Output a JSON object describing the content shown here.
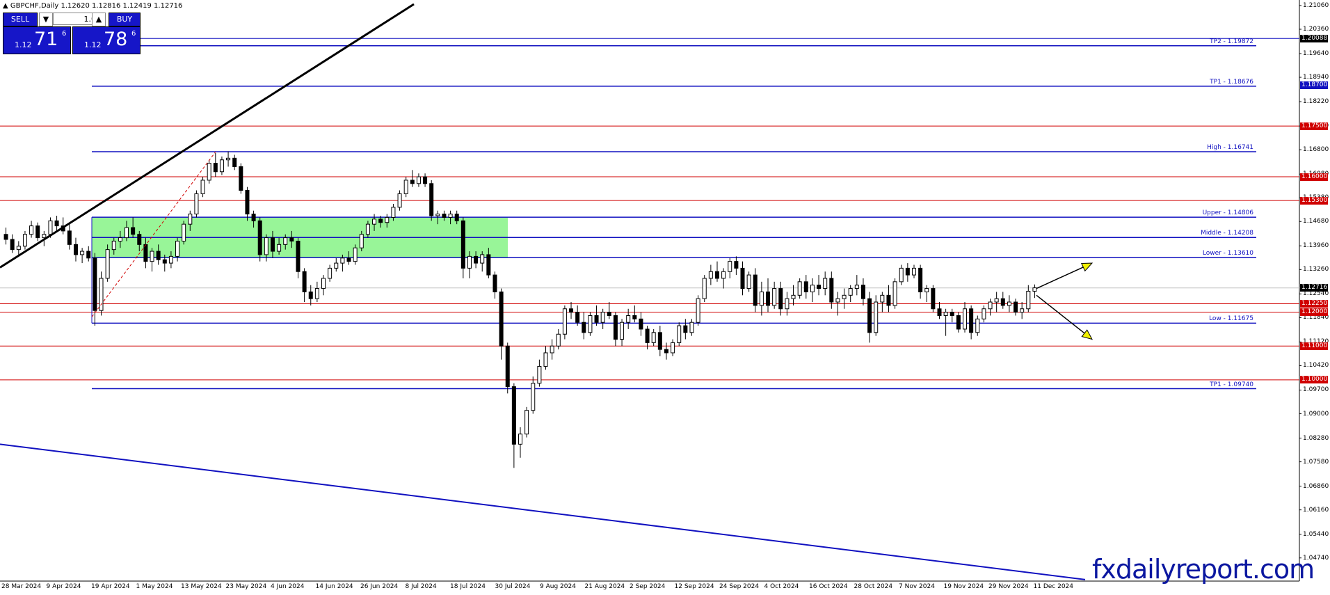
{
  "header": {
    "symbol": "GBPCHF,Daily",
    "ohlc": "1.12620 1.12816 1.12419 1.12716"
  },
  "trade_panel": {
    "sell_label": "SELL",
    "buy_label": "BUY",
    "lot": "1.00",
    "sell_prefix": "1.12",
    "sell_big": "71",
    "sell_sup": "6",
    "buy_prefix": "1.12",
    "buy_big": "78",
    "buy_sup": "6"
  },
  "watermark": "fxdailyreport.com",
  "colors": {
    "blue": "#1010c0",
    "red": "#d00000",
    "green_zone": "#98f598",
    "black": "#000000",
    "arrow_fill": "#f0f000"
  },
  "chart_data": {
    "type": "candlestick",
    "ylim": [
      1.042,
      1.211
    ],
    "y_ticks": [
      "1.21060",
      "1.20360",
      "1.19640",
      "1.18940",
      "1.18220",
      "1.17500",
      "1.16800",
      "1.16080",
      "1.15380",
      "1.14680",
      "1.13960",
      "1.13260",
      "1.12540",
      "1.11840",
      "1.11120",
      "1.10420",
      "1.09700",
      "1.09000",
      "1.08280",
      "1.07580",
      "1.06860",
      "1.06160",
      "1.05440",
      "1.04740"
    ],
    "x_labels": [
      "28 Mar 2024",
      "9 Apr 2024",
      "19 Apr 2024",
      "1 May 2024",
      "13 May 2024",
      "23 May 2024",
      "4 Jun 2024",
      "14 Jun 2024",
      "26 Jun 2024",
      "8 Jul 2024",
      "18 Jul 2024",
      "30 Jul 2024",
      "9 Aug 2024",
      "21 Aug 2024",
      "2 Sep 2024",
      "12 Sep 2024",
      "24 Sep 2024",
      "4 Oct 2024",
      "16 Oct 2024",
      "28 Oct 2024",
      "7 Nov 2024",
      "19 Nov 2024",
      "29 Nov 2024",
      "11 Dec 2024"
    ],
    "current_price": "1.12716",
    "price_badges": [
      {
        "value": "1.20088",
        "color": "#000000"
      },
      {
        "value": "1.18700",
        "color": "#1010c0"
      },
      {
        "value": "1.17500",
        "color": "#d00000"
      },
      {
        "value": "1.16000",
        "color": "#d00000"
      },
      {
        "value": "1.15300",
        "color": "#d00000"
      },
      {
        "value": "1.12716",
        "color": "#000000"
      },
      {
        "value": "1.12250",
        "color": "#d00000"
      },
      {
        "value": "1.12000",
        "color": "#d00000"
      },
      {
        "value": "1.11000",
        "color": "#d00000"
      },
      {
        "value": "1.10000",
        "color": "#d00000"
      }
    ],
    "blue_levels": [
      {
        "label": "TP2 - 1.19872",
        "price": 1.19872
      },
      {
        "label": "TP1 - 1.18676",
        "price": 1.18676
      },
      {
        "label": "High - 1.16741",
        "price": 1.16741
      },
      {
        "label": "Upper - 1.14806",
        "price": 1.14806
      },
      {
        "label": "Middle - 1.14208",
        "price": 1.14208
      },
      {
        "label": "Lower - 1.13610",
        "price": 1.1361
      },
      {
        "label": "Low - 1.11675",
        "price": 1.11675
      },
      {
        "label": "TP1 - 1.09740",
        "price": 1.0974
      }
    ],
    "extra_blue_level": 1.20088,
    "red_levels": [
      1.175,
      1.16,
      1.153,
      1.1225,
      1.12,
      1.11,
      1.1
    ],
    "zone": {
      "top": 1.14806,
      "bottom": 1.1361
    },
    "trendline_black": {
      "from": [
        0,
        1.1332
      ],
      "to": [
        595,
        1.211
      ]
    },
    "trendline_blue": {
      "from": [
        0,
        1.081
      ],
      "to": [
        1560,
        1.041
      ]
    },
    "dashed_red": {
      "from": [
        132,
        1.1186
      ],
      "to": [
        310,
        1.1674
      ]
    },
    "arrows": [
      {
        "from": [
          1490,
          1.127
        ],
        "to": [
          1570,
          1.1345
        ]
      },
      {
        "from": [
          1490,
          1.125
        ],
        "to": [
          1570,
          1.112
        ]
      }
    ],
    "candles": [
      [
        1.143,
        1.145,
        1.14,
        1.1415
      ],
      [
        1.1415,
        1.143,
        1.1375,
        1.1385
      ],
      [
        1.1385,
        1.141,
        1.1365,
        1.1395
      ],
      [
        1.1395,
        1.144,
        1.1385,
        1.143
      ],
      [
        1.143,
        1.147,
        1.142,
        1.1455
      ],
      [
        1.1455,
        1.1465,
        1.141,
        1.142
      ],
      [
        1.142,
        1.144,
        1.1395,
        1.143
      ],
      [
        1.143,
        1.148,
        1.142,
        1.147
      ],
      [
        1.147,
        1.1485,
        1.144,
        1.1455
      ],
      [
        1.1455,
        1.148,
        1.143,
        1.144
      ],
      [
        1.144,
        1.146,
        1.1385,
        1.14
      ],
      [
        1.14,
        1.142,
        1.135,
        1.137
      ],
      [
        1.137,
        1.139,
        1.1345,
        1.138
      ],
      [
        1.138,
        1.1395,
        1.135,
        1.136
      ],
      [
        1.136,
        1.1375,
        1.116,
        1.1205
      ],
      [
        1.1205,
        1.132,
        1.119,
        1.13
      ],
      [
        1.13,
        1.14,
        1.129,
        1.1385
      ],
      [
        1.1385,
        1.142,
        1.137,
        1.141
      ],
      [
        1.141,
        1.144,
        1.139,
        1.142
      ],
      [
        1.142,
        1.147,
        1.141,
        1.145
      ],
      [
        1.145,
        1.148,
        1.142,
        1.143
      ],
      [
        1.143,
        1.144,
        1.138,
        1.14
      ],
      [
        1.14,
        1.142,
        1.133,
        1.135
      ],
      [
        1.135,
        1.139,
        1.132,
        1.138
      ],
      [
        1.138,
        1.14,
        1.134,
        1.1355
      ],
      [
        1.1355,
        1.137,
        1.132,
        1.1345
      ],
      [
        1.1345,
        1.138,
        1.133,
        1.1365
      ],
      [
        1.1365,
        1.142,
        1.135,
        1.141
      ],
      [
        1.141,
        1.147,
        1.14,
        1.146
      ],
      [
        1.146,
        1.15,
        1.144,
        1.149
      ],
      [
        1.149,
        1.156,
        1.148,
        1.155
      ],
      [
        1.155,
        1.16,
        1.154,
        1.159
      ],
      [
        1.159,
        1.165,
        1.158,
        1.164
      ],
      [
        1.164,
        1.167,
        1.16,
        1.1615
      ],
      [
        1.1615,
        1.166,
        1.1605,
        1.165
      ],
      [
        1.165,
        1.1675,
        1.163,
        1.1655
      ],
      [
        1.1655,
        1.1665,
        1.162,
        1.163
      ],
      [
        1.163,
        1.164,
        1.155,
        1.156
      ],
      [
        1.156,
        1.157,
        1.147,
        1.149
      ],
      [
        1.149,
        1.15,
        1.145,
        1.147
      ],
      [
        1.147,
        1.148,
        1.135,
        1.137
      ],
      [
        1.137,
        1.143,
        1.135,
        1.142
      ],
      [
        1.142,
        1.144,
        1.136,
        1.138
      ],
      [
        1.138,
        1.142,
        1.137,
        1.14
      ],
      [
        1.14,
        1.143,
        1.1385,
        1.142
      ],
      [
        1.142,
        1.144,
        1.139,
        1.141
      ],
      [
        1.141,
        1.142,
        1.13,
        1.132
      ],
      [
        1.132,
        1.133,
        1.123,
        1.126
      ],
      [
        1.126,
        1.128,
        1.122,
        1.124
      ],
      [
        1.124,
        1.129,
        1.123,
        1.127
      ],
      [
        1.127,
        1.131,
        1.125,
        1.13
      ],
      [
        1.13,
        1.134,
        1.129,
        1.133
      ],
      [
        1.133,
        1.136,
        1.132,
        1.1345
      ],
      [
        1.1345,
        1.137,
        1.132,
        1.136
      ],
      [
        1.136,
        1.138,
        1.134,
        1.135
      ],
      [
        1.135,
        1.14,
        1.134,
        1.139
      ],
      [
        1.139,
        1.144,
        1.138,
        1.143
      ],
      [
        1.143,
        1.147,
        1.142,
        1.146
      ],
      [
        1.146,
        1.149,
        1.144,
        1.1475
      ],
      [
        1.1475,
        1.1485,
        1.145,
        1.1465
      ],
      [
        1.1465,
        1.149,
        1.145,
        1.148
      ],
      [
        1.148,
        1.152,
        1.147,
        1.151
      ],
      [
        1.151,
        1.156,
        1.15,
        1.155
      ],
      [
        1.155,
        1.16,
        1.154,
        1.159
      ],
      [
        1.159,
        1.162,
        1.157,
        1.158
      ],
      [
        1.158,
        1.161,
        1.157,
        1.16
      ],
      [
        1.16,
        1.161,
        1.157,
        1.158
      ],
      [
        1.158,
        1.159,
        1.147,
        1.1485
      ],
      [
        1.1485,
        1.15,
        1.146,
        1.149
      ],
      [
        1.149,
        1.15,
        1.147,
        1.148
      ],
      [
        1.148,
        1.15,
        1.146,
        1.149
      ],
      [
        1.149,
        1.15,
        1.146,
        1.147
      ],
      [
        1.147,
        1.148,
        1.13,
        1.133
      ],
      [
        1.133,
        1.138,
        1.13,
        1.1365
      ],
      [
        1.1365,
        1.138,
        1.133,
        1.1345
      ],
      [
        1.1345,
        1.138,
        1.132,
        1.137
      ],
      [
        1.137,
        1.139,
        1.13,
        1.131
      ],
      [
        1.131,
        1.132,
        1.124,
        1.126
      ],
      [
        1.126,
        1.127,
        1.106,
        1.11
      ],
      [
        1.11,
        1.111,
        1.096,
        1.098
      ],
      [
        1.098,
        1.099,
        1.074,
        1.081
      ],
      [
        1.081,
        1.086,
        1.077,
        1.084
      ],
      [
        1.084,
        1.092,
        1.083,
        1.091
      ],
      [
        1.091,
        1.101,
        1.09,
        1.099
      ],
      [
        1.099,
        1.106,
        1.098,
        1.104
      ],
      [
        1.104,
        1.11,
        1.103,
        1.108
      ],
      [
        1.108,
        1.112,
        1.106,
        1.11
      ],
      [
        1.11,
        1.115,
        1.109,
        1.1135
      ],
      [
        1.1135,
        1.122,
        1.112,
        1.121
      ],
      [
        1.121,
        1.123,
        1.118,
        1.12
      ],
      [
        1.12,
        1.122,
        1.116,
        1.117
      ],
      [
        1.117,
        1.12,
        1.112,
        1.114
      ],
      [
        1.114,
        1.12,
        1.113,
        1.119
      ],
      [
        1.119,
        1.122,
        1.116,
        1.117
      ],
      [
        1.117,
        1.121,
        1.115,
        1.12
      ],
      [
        1.12,
        1.123,
        1.118,
        1.119
      ],
      [
        1.119,
        1.12,
        1.11,
        1.112
      ],
      [
        1.112,
        1.118,
        1.11,
        1.117
      ],
      [
        1.117,
        1.121,
        1.115,
        1.119
      ],
      [
        1.119,
        1.122,
        1.117,
        1.118
      ],
      [
        1.118,
        1.12,
        1.113,
        1.115
      ],
      [
        1.115,
        1.116,
        1.109,
        1.111
      ],
      [
        1.111,
        1.115,
        1.11,
        1.114
      ],
      [
        1.114,
        1.116,
        1.107,
        1.109
      ],
      [
        1.109,
        1.111,
        1.106,
        1.108
      ],
      [
        1.108,
        1.112,
        1.107,
        1.111
      ],
      [
        1.111,
        1.117,
        1.11,
        1.116
      ],
      [
        1.116,
        1.118,
        1.112,
        1.114
      ],
      [
        1.114,
        1.118,
        1.113,
        1.117
      ],
      [
        1.117,
        1.125,
        1.116,
        1.124
      ],
      [
        1.124,
        1.131,
        1.123,
        1.13
      ],
      [
        1.13,
        1.134,
        1.128,
        1.132
      ],
      [
        1.132,
        1.135,
        1.129,
        1.13
      ],
      [
        1.13,
        1.133,
        1.127,
        1.132
      ],
      [
        1.132,
        1.136,
        1.13,
        1.135
      ],
      [
        1.135,
        1.1365,
        1.131,
        1.133
      ],
      [
        1.133,
        1.135,
        1.125,
        1.127
      ],
      [
        1.127,
        1.132,
        1.126,
        1.131
      ],
      [
        1.131,
        1.133,
        1.12,
        1.122
      ],
      [
        1.122,
        1.129,
        1.119,
        1.126
      ],
      [
        1.126,
        1.13,
        1.12,
        1.122
      ],
      [
        1.122,
        1.129,
        1.121,
        1.127
      ],
      [
        1.127,
        1.129,
        1.119,
        1.121
      ],
      [
        1.121,
        1.126,
        1.119,
        1.124
      ],
      [
        1.124,
        1.128,
        1.122,
        1.125
      ],
      [
        1.125,
        1.13,
        1.124,
        1.129
      ],
      [
        1.129,
        1.131,
        1.124,
        1.126
      ],
      [
        1.126,
        1.13,
        1.123,
        1.128
      ],
      [
        1.128,
        1.131,
        1.125,
        1.127
      ],
      [
        1.127,
        1.132,
        1.125,
        1.13
      ],
      [
        1.13,
        1.132,
        1.121,
        1.123
      ],
      [
        1.123,
        1.126,
        1.119,
        1.124
      ],
      [
        1.124,
        1.127,
        1.121,
        1.125
      ],
      [
        1.125,
        1.128,
        1.123,
        1.127
      ],
      [
        1.127,
        1.131,
        1.125,
        1.128
      ],
      [
        1.128,
        1.13,
        1.122,
        1.124
      ],
      [
        1.124,
        1.126,
        1.111,
        1.114
      ],
      [
        1.114,
        1.125,
        1.113,
        1.123
      ],
      [
        1.123,
        1.126,
        1.12,
        1.125
      ],
      [
        1.125,
        1.128,
        1.12,
        1.122
      ],
      [
        1.122,
        1.13,
        1.121,
        1.129
      ],
      [
        1.129,
        1.134,
        1.128,
        1.133
      ],
      [
        1.133,
        1.1345,
        1.129,
        1.131
      ],
      [
        1.131,
        1.134,
        1.13,
        1.133
      ],
      [
        1.133,
        1.134,
        1.124,
        1.126
      ],
      [
        1.126,
        1.128,
        1.123,
        1.127
      ],
      [
        1.127,
        1.128,
        1.12,
        1.121
      ],
      [
        1.121,
        1.123,
        1.118,
        1.119
      ],
      [
        1.119,
        1.121,
        1.113,
        1.12
      ],
      [
        1.12,
        1.121,
        1.117,
        1.119
      ],
      [
        1.119,
        1.12,
        1.114,
        1.115
      ],
      [
        1.115,
        1.123,
        1.114,
        1.121
      ],
      [
        1.121,
        1.122,
        1.112,
        1.114
      ],
      [
        1.114,
        1.119,
        1.113,
        1.118
      ],
      [
        1.118,
        1.122,
        1.117,
        1.121
      ],
      [
        1.121,
        1.124,
        1.119,
        1.123
      ],
      [
        1.123,
        1.126,
        1.12,
        1.124
      ],
      [
        1.124,
        1.126,
        1.121,
        1.122
      ],
      [
        1.122,
        1.125,
        1.12,
        1.123
      ],
      [
        1.123,
        1.124,
        1.119,
        1.12
      ],
      [
        1.12,
        1.123,
        1.118,
        1.121
      ],
      [
        1.121,
        1.128,
        1.12,
        1.1262
      ],
      [
        1.1262,
        1.1282,
        1.1242,
        1.1272
      ]
    ]
  }
}
